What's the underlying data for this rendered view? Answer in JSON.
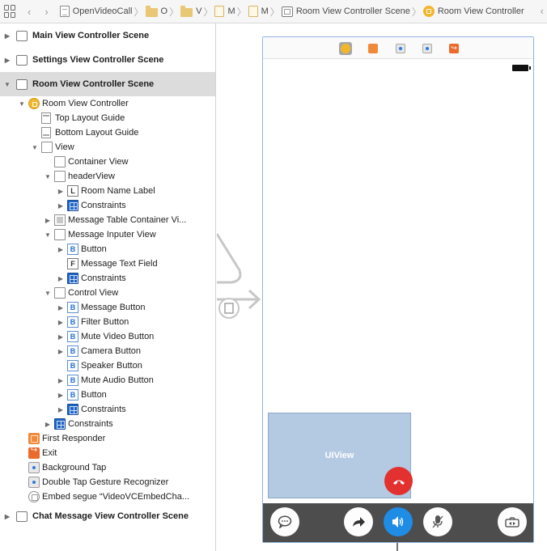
{
  "jumpbar": {
    "project": "OpenVideoCall",
    "crumbs": [
      "O",
      "V",
      "M",
      "M"
    ],
    "scene": "Room View Controller Scene",
    "controller": "Room View Controller"
  },
  "outline": {
    "scenes": {
      "main": "Main View Controller Scene",
      "settings": "Settings View Controller Scene",
      "room": "Room View Controller Scene",
      "chat": "Chat Message View Controller Scene"
    },
    "items": {
      "room_vc": "Room View Controller",
      "top_guide": "Top Layout Guide",
      "bottom_guide": "Bottom Layout Guide",
      "view": "View",
      "container_view": "Container View",
      "header_view": "headerView",
      "room_name_label": "Room Name Label",
      "header_constraints": "Constraints",
      "message_table": "Message Table Container Vi...",
      "message_inputer": "Message Inputer View",
      "inputer_button": "Button",
      "message_text_field": "Message Text Field",
      "inputer_constraints": "Constraints",
      "control_view": "Control View",
      "message_button": "Message Button",
      "filter_button": "Filter Button",
      "mute_video_button": "Mute Video Button",
      "camera_button": "Camera Button",
      "speaker_button": "Speaker Button",
      "mute_audio_button": "Mute Audio Button",
      "control_button": "Button",
      "control_constraints": "Constraints",
      "view_constraints": "Constraints",
      "first_responder": "First Responder",
      "exit": "Exit",
      "background_tap": "Background Tap",
      "double_tap": "Double Tap Gesture Recognizer",
      "embed_segue": "Embed segue “VideoVCEmbedCha..."
    },
    "letters": {
      "label": "L",
      "button": "B",
      "field": "F"
    }
  },
  "canvas": {
    "uiview_label": "UIView",
    "colors": {
      "accent": "#1f8ce6",
      "hangup": "#e2312e",
      "uiview": "#b4c9e2",
      "toolbar": "#4d4d4d",
      "vc_icon": "#f2b62c"
    },
    "toolbar_icons": [
      "message-icon",
      "share-icon",
      "speaker-icon",
      "mute-mic-icon",
      "camera-switch-icon"
    ]
  }
}
